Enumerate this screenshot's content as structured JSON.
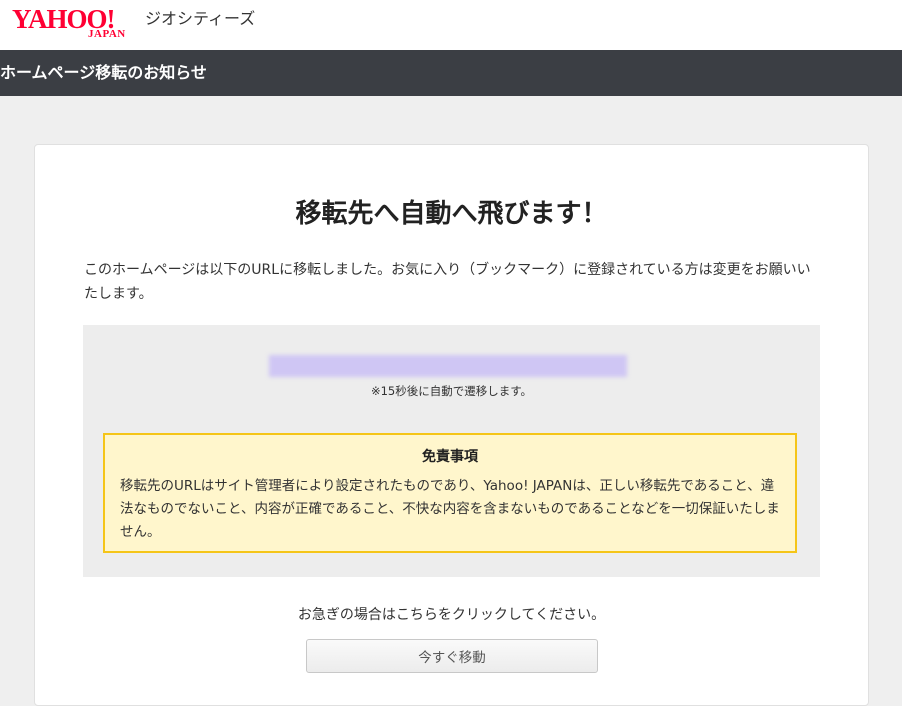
{
  "header": {
    "logo_main": "YAHOO!",
    "logo_sub": "JAPAN",
    "service_name": "ジオシティーズ"
  },
  "titlebar": {
    "title": "ホームページ移転のお知らせ"
  },
  "main": {
    "heading": "移転先へ自動へ飛びます！",
    "description": "このホームページは以下のURLに移転しました。お気に入り（ブックマーク）に登録されている方は変更をお願いいたします。",
    "redirect_note": "※15秒後に自動で遷移します。",
    "disclaimer": {
      "title": "免責事項",
      "body": "移転先のURLはサイト管理者により設定されたものであり、Yahoo! JAPANは、正しい移転先であること、違法なものでないこと、内容が正確であること、不快な内容を含まないものであることなどを一切保証いたしません。"
    },
    "hurry_text": "お急ぎの場合はこちらをクリックしてください。",
    "move_button_label": "今すぐ移動"
  },
  "colors": {
    "brand": "#ff0033",
    "titlebar_bg": "#3b3e44",
    "disclaimer_bg": "#fff6cc",
    "disclaimer_border": "#f5c518"
  }
}
